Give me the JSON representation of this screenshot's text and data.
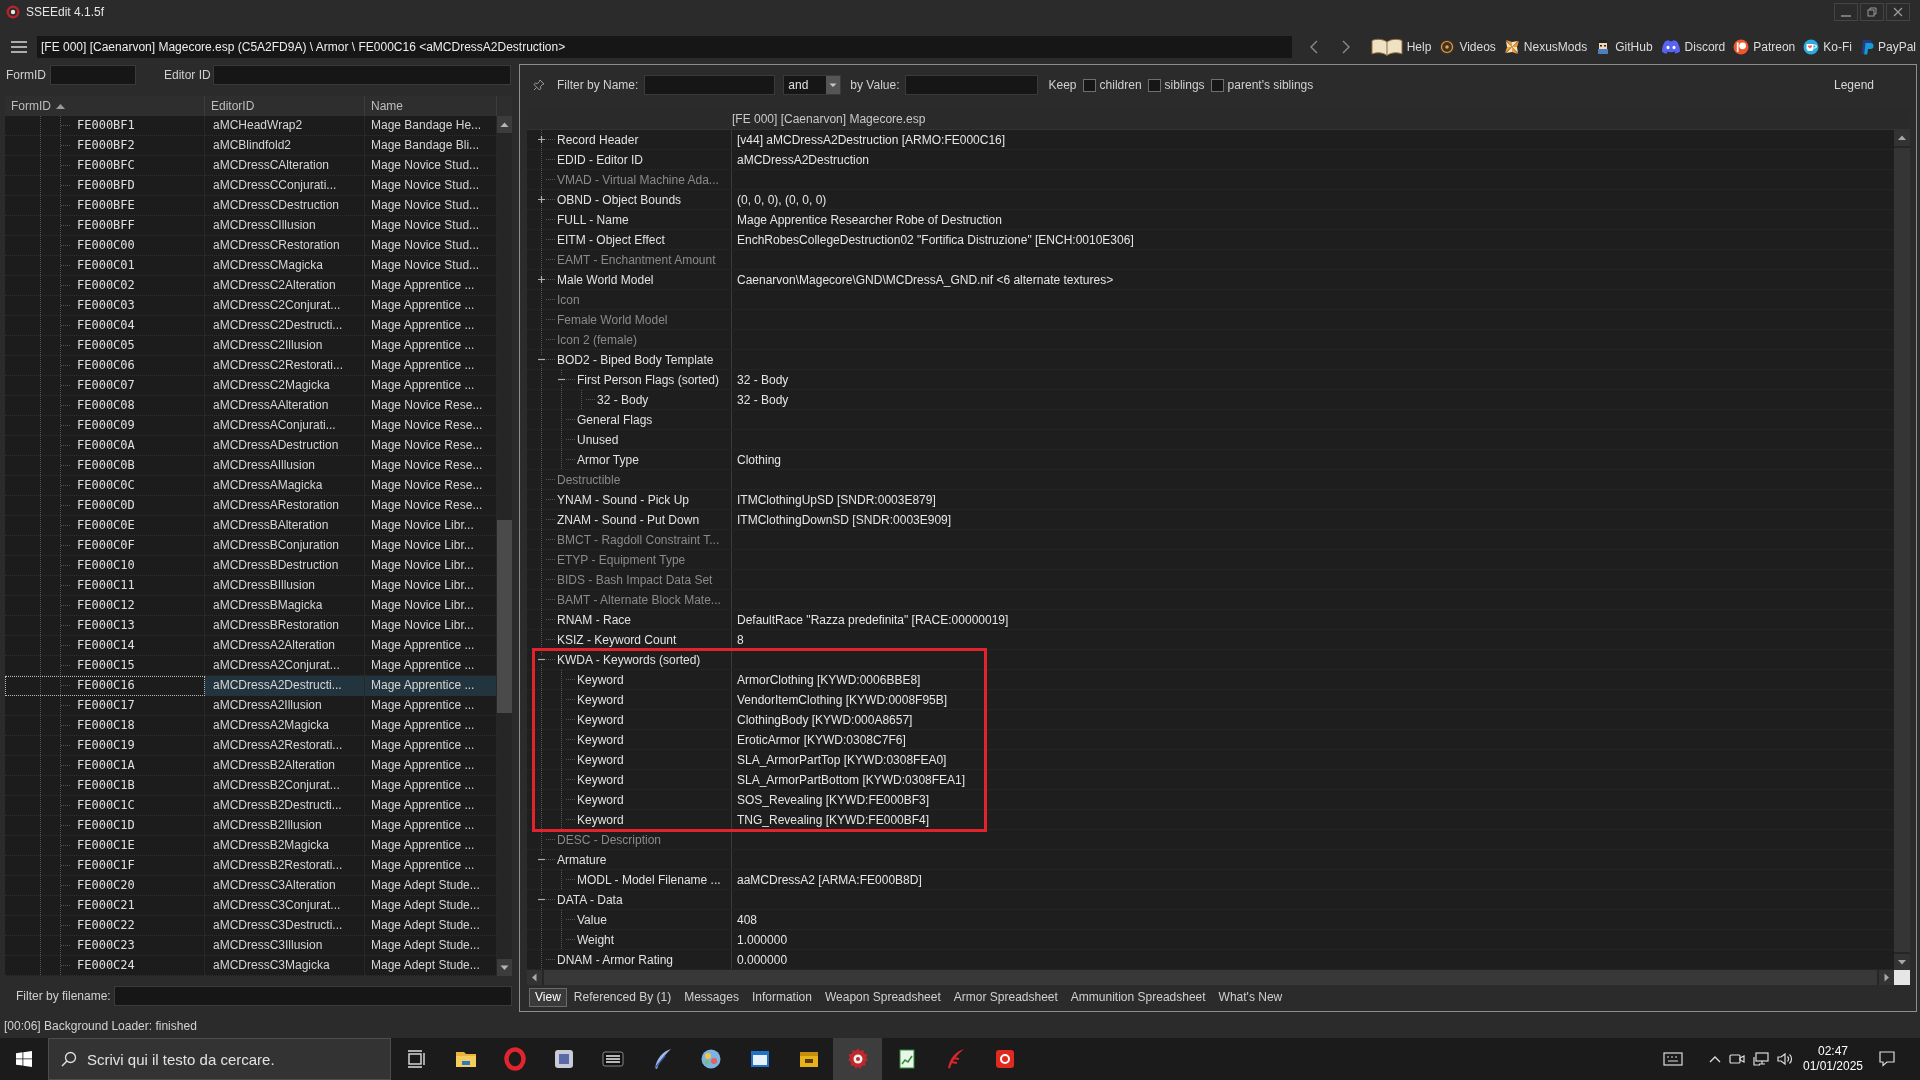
{
  "window": {
    "title": "SSEEdit 4.1.5f"
  },
  "path_bar": {
    "path": "[FE 000] [Caenarvon] Magecore.esp (C5A2FD9A) \\ Armor \\ FE000C16 <aMCDressA2Destruction>"
  },
  "links": [
    {
      "label": "Help",
      "kind": "book"
    },
    {
      "label": "Videos",
      "kind": "coin"
    },
    {
      "label": "NexusMods",
      "kind": "pinwheel"
    },
    {
      "label": "GitHub",
      "kind": "character"
    },
    {
      "label": "Discord",
      "kind": "controller"
    },
    {
      "label": "Patreon",
      "kind": "disc"
    },
    {
      "label": "Ko-Fi",
      "kind": "cup"
    },
    {
      "label": "PayPal",
      "kind": "shapes"
    }
  ],
  "left_panel": {
    "filters": [
      {
        "label": "FormID"
      },
      {
        "label": "Editor ID"
      }
    ],
    "columns": [
      {
        "label": "FormID",
        "sorted": true
      },
      {
        "label": "EditorID",
        "sorted": false
      },
      {
        "label": "Name",
        "sorted": false
      }
    ],
    "rows": [
      {
        "form_id": "FE000BF1",
        "editor_id": "aMCHeadWrap2",
        "name": "Mage Bandage He...",
        "selected": false
      },
      {
        "form_id": "FE000BF2",
        "editor_id": "aMCBlindfold2",
        "name": "Mage Bandage Bli...",
        "selected": false
      },
      {
        "form_id": "FE000BFC",
        "editor_id": "aMCDressCAlteration",
        "name": "Mage Novice Stud...",
        "selected": false
      },
      {
        "form_id": "FE000BFD",
        "editor_id": "aMCDressCConjurati...",
        "name": "Mage Novice Stud...",
        "selected": false
      },
      {
        "form_id": "FE000BFE",
        "editor_id": "aMCDressCDestruction",
        "name": "Mage Novice Stud...",
        "selected": false
      },
      {
        "form_id": "FE000BFF",
        "editor_id": "aMCDressCIllusion",
        "name": "Mage Novice Stud...",
        "selected": false
      },
      {
        "form_id": "FE000C00",
        "editor_id": "aMCDressCRestoration",
        "name": "Mage Novice Stud...",
        "selected": false
      },
      {
        "form_id": "FE000C01",
        "editor_id": "aMCDressCMagicka",
        "name": "Mage Novice Stud...",
        "selected": false
      },
      {
        "form_id": "FE000C02",
        "editor_id": "aMCDressC2Alteration",
        "name": "Mage Apprentice ...",
        "selected": false
      },
      {
        "form_id": "FE000C03",
        "editor_id": "aMCDressC2Conjurat...",
        "name": "Mage Apprentice ...",
        "selected": false
      },
      {
        "form_id": "FE000C04",
        "editor_id": "aMCDressC2Destructi...",
        "name": "Mage Apprentice ...",
        "selected": false
      },
      {
        "form_id": "FE000C05",
        "editor_id": "aMCDressC2Illusion",
        "name": "Mage Apprentice ...",
        "selected": false
      },
      {
        "form_id": "FE000C06",
        "editor_id": "aMCDressC2Restorati...",
        "name": "Mage Apprentice ...",
        "selected": false
      },
      {
        "form_id": "FE000C07",
        "editor_id": "aMCDressC2Magicka",
        "name": "Mage Apprentice ...",
        "selected": false
      },
      {
        "form_id": "FE000C08",
        "editor_id": "aMCDressAAlteration",
        "name": "Mage Novice Rese...",
        "selected": false
      },
      {
        "form_id": "FE000C09",
        "editor_id": "aMCDressAConjurati...",
        "name": "Mage Novice Rese...",
        "selected": false
      },
      {
        "form_id": "FE000C0A",
        "editor_id": "aMCDressADestruction",
        "name": "Mage Novice Rese...",
        "selected": false
      },
      {
        "form_id": "FE000C0B",
        "editor_id": "aMCDressAIllusion",
        "name": "Mage Novice Rese...",
        "selected": false
      },
      {
        "form_id": "FE000C0C",
        "editor_id": "aMCDressAMagicka",
        "name": "Mage Novice Rese...",
        "selected": false
      },
      {
        "form_id": "FE000C0D",
        "editor_id": "aMCDressARestoration",
        "name": "Mage Novice Rese...",
        "selected": false
      },
      {
        "form_id": "FE000C0E",
        "editor_id": "aMCDressBAlteration",
        "name": "Mage Novice Libr...",
        "selected": false
      },
      {
        "form_id": "FE000C0F",
        "editor_id": "aMCDressBConjuration",
        "name": "Mage Novice Libr...",
        "selected": false
      },
      {
        "form_id": "FE000C10",
        "editor_id": "aMCDressBDestruction",
        "name": "Mage Novice Libr...",
        "selected": false
      },
      {
        "form_id": "FE000C11",
        "editor_id": "aMCDressBIllusion",
        "name": "Mage Novice Libr...",
        "selected": false
      },
      {
        "form_id": "FE000C12",
        "editor_id": "aMCDressBMagicka",
        "name": "Mage Novice Libr...",
        "selected": false
      },
      {
        "form_id": "FE000C13",
        "editor_id": "aMCDressBRestoration",
        "name": "Mage Novice Libr...",
        "selected": false
      },
      {
        "form_id": "FE000C14",
        "editor_id": "aMCDressA2Alteration",
        "name": "Mage Apprentice ...",
        "selected": false
      },
      {
        "form_id": "FE000C15",
        "editor_id": "aMCDressA2Conjurat...",
        "name": "Mage Apprentice ...",
        "selected": false
      },
      {
        "form_id": "FE000C16",
        "editor_id": "aMCDressA2Destructi...",
        "name": "Mage Apprentice ...",
        "selected": true
      },
      {
        "form_id": "FE000C17",
        "editor_id": "aMCDressA2Illusion",
        "name": "Mage Apprentice ...",
        "selected": false
      },
      {
        "form_id": "FE000C18",
        "editor_id": "aMCDressA2Magicka",
        "name": "Mage Apprentice ...",
        "selected": false
      },
      {
        "form_id": "FE000C19",
        "editor_id": "aMCDressA2Restorati...",
        "name": "Mage Apprentice ...",
        "selected": false
      },
      {
        "form_id": "FE000C1A",
        "editor_id": "aMCDressB2Alteration",
        "name": "Mage Apprentice ...",
        "selected": false
      },
      {
        "form_id": "FE000C1B",
        "editor_id": "aMCDressB2Conjurat...",
        "name": "Mage Apprentice ...",
        "selected": false
      },
      {
        "form_id": "FE000C1C",
        "editor_id": "aMCDressB2Destructi...",
        "name": "Mage Apprentice ...",
        "selected": false
      },
      {
        "form_id": "FE000C1D",
        "editor_id": "aMCDressB2Illusion",
        "name": "Mage Apprentice ...",
        "selected": false
      },
      {
        "form_id": "FE000C1E",
        "editor_id": "aMCDressB2Magicka",
        "name": "Mage Apprentice ...",
        "selected": false
      },
      {
        "form_id": "FE000C1F",
        "editor_id": "aMCDressB2Restorati...",
        "name": "Mage Apprentice ...",
        "selected": false
      },
      {
        "form_id": "FE000C20",
        "editor_id": "aMCDressC3Alteration",
        "name": "Mage Adept Stude...",
        "selected": false
      },
      {
        "form_id": "FE000C21",
        "editor_id": "aMCDressC3Conjurat...",
        "name": "Mage Adept Stude...",
        "selected": false
      },
      {
        "form_id": "FE000C22",
        "editor_id": "aMCDressC3Destructi...",
        "name": "Mage Adept Stude...",
        "selected": false
      },
      {
        "form_id": "FE000C23",
        "editor_id": "aMCDressC3Illusion",
        "name": "Mage Adept Stude...",
        "selected": false
      },
      {
        "form_id": "FE000C24",
        "editor_id": "aMCDressC3Magicka",
        "name": "Mage Adept Stude...",
        "selected": false
      }
    ],
    "filename_filter": {
      "label": "Filter by filename:"
    }
  },
  "record_panel": {
    "filter": {
      "name_label": "Filter by Name:",
      "operator": "and",
      "value_label": "by Value:",
      "keep_label": "Keep",
      "options": [
        {
          "label": "children",
          "checked": false
        },
        {
          "label": "siblings",
          "checked": false
        },
        {
          "label": "parent's siblings",
          "checked": false
        }
      ],
      "legend": "Legend"
    },
    "header": "[FE 000] [Caenarvon] Magecore.esp",
    "fields": [
      {
        "label": "Record Header",
        "value": "[v44] aMCDressA2Destruction [ARMO:FE000C16]",
        "greyed": false,
        "expanded": false
      },
      {
        "label": "EDID - Editor ID",
        "value": "aMCDressA2Destruction",
        "greyed": false
      },
      {
        "label": "VMAD - Virtual Machine Ada...",
        "greyed": true
      },
      {
        "label": "OBND - Object Bounds",
        "value": "(0, 0, 0), (0, 0, 0)",
        "greyed": false,
        "expanded": false
      },
      {
        "label": "FULL - Name",
        "value": "Mage Apprentice Researcher Robe of Destruction",
        "greyed": false
      },
      {
        "label": "EITM - Object Effect",
        "value": "EnchRobesCollegeDestruction02 \"Fortifica Distruzione\" [ENCH:0010E306]",
        "greyed": false
      },
      {
        "label": "EAMT - Enchantment Amount",
        "greyed": true
      },
      {
        "label": "Male World Model",
        "value": "Caenarvon\\Magecore\\GND\\MCDressA_GND.nif <6 alternate textures>",
        "greyed": false,
        "expanded": false
      },
      {
        "label": "Icon",
        "greyed": true
      },
      {
        "label": "Female World Model",
        "greyed": true
      },
      {
        "label": "Icon 2 (female)",
        "greyed": true
      },
      {
        "label": "BOD2 - Biped Body Template",
        "greyed": false,
        "expanded": true,
        "children": [
          {
            "label": "First Person Flags (sorted)",
            "value": "32 - Body",
            "greyed": false,
            "expanded": true,
            "children": [
              {
                "label": "32 - Body",
                "value": "32 - Body",
                "greyed": false
              }
            ]
          },
          {
            "label": "General Flags",
            "greyed": false
          },
          {
            "label": "Unused",
            "greyed": false
          },
          {
            "label": "Armor Type",
            "value": "Clothing",
            "greyed": false
          }
        ]
      },
      {
        "label": "Destructible",
        "greyed": true
      },
      {
        "label": "YNAM - Sound - Pick Up",
        "value": "ITMClothingUpSD [SNDR:0003E879]",
        "greyed": false
      },
      {
        "label": "ZNAM - Sound - Put Down",
        "value": "ITMClothingDownSD [SNDR:0003E909]",
        "greyed": false
      },
      {
        "label": "BMCT - Ragdoll Constraint T...",
        "greyed": true
      },
      {
        "label": "ETYP - Equipment Type",
        "greyed": true
      },
      {
        "label": "BIDS - Bash Impact Data Set",
        "greyed": true
      },
      {
        "label": "BAMT - Alternate Block Mate...",
        "greyed": true
      },
      {
        "label": "RNAM - Race",
        "value": "DefaultRace \"Razza predefinita\" [RACE:00000019]",
        "greyed": false
      },
      {
        "label": "KSIZ - Keyword Count",
        "value": "8",
        "greyed": false
      },
      {
        "label": "KWDA - Keywords (sorted)",
        "greyed": false,
        "expanded": true,
        "children": [
          {
            "label": "Keyword",
            "value": "ArmorClothing [KYWD:0006BBE8]",
            "greyed": false
          },
          {
            "label": "Keyword",
            "value": "VendorItemClothing [KYWD:0008F95B]",
            "greyed": false
          },
          {
            "label": "Keyword",
            "value": "ClothingBody [KYWD:000A8657]",
            "greyed": false
          },
          {
            "label": "Keyword",
            "value": "EroticArmor [KYWD:0308C7F6]",
            "greyed": false
          },
          {
            "label": "Keyword",
            "value": "SLA_ArmorPartTop [KYWD:0308FEA0]",
            "greyed": false
          },
          {
            "label": "Keyword",
            "value": "SLA_ArmorPartBottom [KYWD:0308FEA1]",
            "greyed": false
          },
          {
            "label": "Keyword",
            "value": "SOS_Revealing [KYWD:FE000BF3]",
            "greyed": false
          },
          {
            "label": "Keyword",
            "value": "TNG_Revealing [KYWD:FE000BF4]",
            "greyed": false
          }
        ]
      },
      {
        "label": "DESC - Description",
        "greyed": true
      },
      {
        "label": "Armature",
        "greyed": false,
        "expanded": true,
        "children": [
          {
            "label": "MODL - Model Filename ...",
            "value": "aaMCDressA2 [ARMA:FE000B8D]",
            "greyed": false
          }
        ]
      },
      {
        "label": "DATA - Data",
        "greyed": false,
        "expanded": true,
        "children": [
          {
            "label": "Value",
            "value": "408",
            "greyed": false
          },
          {
            "label": "Weight",
            "value": "1.000000",
            "greyed": false
          }
        ]
      },
      {
        "label": "DNAM - Armor Rating",
        "value": "0.000000",
        "greyed": false
      }
    ],
    "tabs": [
      {
        "label": "View",
        "selected": true
      },
      {
        "label": "Referenced By (1)",
        "selected": false
      },
      {
        "label": "Messages",
        "selected": false
      },
      {
        "label": "Information",
        "selected": false
      },
      {
        "label": "Weapon Spreadsheet",
        "selected": false
      },
      {
        "label": "Armor Spreadsheet",
        "selected": false
      },
      {
        "label": "Ammunition Spreadsheet",
        "selected": false
      },
      {
        "label": "What's New",
        "selected": false
      }
    ]
  },
  "status_bar": {
    "text": "[00:06] Background Loader: finished"
  },
  "taskbar": {
    "search_placeholder": "Scrivi qui il testo da cercare.",
    "apps": [
      {
        "kind": "folder",
        "active": false
      },
      {
        "kind": "ring",
        "active": false
      },
      {
        "kind": "framed-square",
        "active": false
      },
      {
        "kind": "striped-tile",
        "active": false
      },
      {
        "kind": "quill",
        "active": false
      },
      {
        "kind": "dotted-disc",
        "active": false
      },
      {
        "kind": "window",
        "active": false
      },
      {
        "kind": "box",
        "active": false
      },
      {
        "kind": "gear",
        "active": true
      },
      {
        "kind": "chart-sheet",
        "active": false
      },
      {
        "kind": "feather",
        "active": false
      },
      {
        "kind": "rounded-square",
        "active": false
      }
    ],
    "time": "02:47",
    "date": "01/01/2025"
  }
}
